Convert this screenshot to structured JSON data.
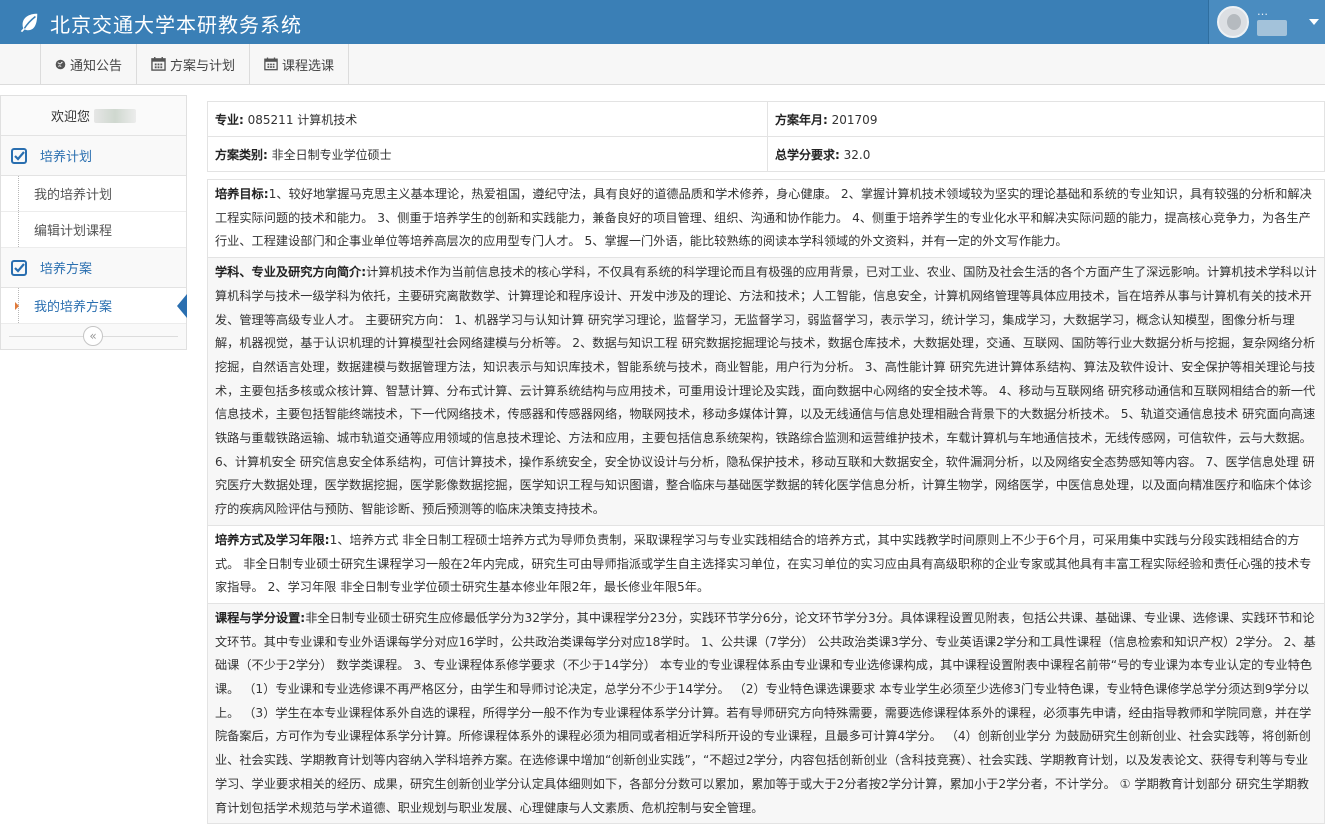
{
  "header": {
    "app_title": "北京交通大学本研教务系统",
    "user_name": "…"
  },
  "nav": {
    "items": [
      {
        "label": "通知公告",
        "icon": "globe-icon"
      },
      {
        "label": "方案与计划",
        "icon": "calendar-icon"
      },
      {
        "label": "课程选课",
        "icon": "calendar-icon"
      }
    ]
  },
  "sidebar": {
    "welcome": "欢迎您",
    "group1": "培养计划",
    "group1_items": [
      "我的培养计划",
      "编辑计划课程"
    ],
    "group2": "培养方案",
    "group2_items": [
      "我的培养方案"
    ],
    "collapse_icon": "«"
  },
  "info": {
    "major_label": "专业:",
    "major_value": "085211 计算机技术",
    "plan_date_label": "方案年月:",
    "plan_date_value": "201709",
    "category_label": "方案类别:",
    "category_value": "非全日制专业学位硕士",
    "credits_label": "总学分要求:",
    "credits_value": "32.0"
  },
  "sections": [
    {
      "title": "培养目标:",
      "text": "1、较好地掌握马克思主义基本理论，热爱祖国，遵纪守法，具有良好的道德品质和学术修养，身心健康。 2、掌握计算机技术领域较为坚实的理论基础和系统的专业知识，具有较强的分析和解决工程实际问题的技术和能力。 3、侧重于培养学生的创新和实践能力，兼备良好的项目管理、组织、沟通和协作能力。 4、侧重于培养学生的专业化水平和解决实际问题的能力，提高核心竞争力，为各生产行业、工程建设部门和企事业单位等培养高层次的应用型专门人才。 5、掌握一门外语，能比较熟练的阅读本学科领域的外文资料，并有一定的外文写作能力。"
    },
    {
      "title": "学科、专业及研究方向简介:",
      "text": "计算机技术作为当前信息技术的核心学科，不仅具有系统的科学理论而且有极强的应用背景，已对工业、农业、国防及社会生活的各个方面产生了深远影响。计算机技术学科以计算机科学与技术一级学科为依托，主要研究离散数学、计算理论和程序设计、开发中涉及的理论、方法和技术；人工智能，信息安全，计算机网络管理等具体应用技术，旨在培养从事与计算机有关的技术开发、管理等高级专业人才。 主要研究方向： 1、机器学习与认知计算 研究学习理论，监督学习，无监督学习，弱监督学习，表示学习，统计学习，集成学习，大数据学习，概念认知模型，图像分析与理解，机器视觉，基于认识机理的计算模型社会网络建模与分析等。 2、数据与知识工程 研究数据挖掘理论与技术，数据仓库技术，大数据处理，交通、互联网、国防等行业大数据分析与挖掘，复杂网络分析挖掘，自然语言处理，数据建模与数据管理方法，知识表示与知识库技术，智能系统与技术，商业智能，用户行为分析。 3、高性能计算 研究先进计算体系结构、算法及软件设计、安全保护等相关理论与技术，主要包括多核或众核计算、智慧计算、分布式计算、云计算系统结构与应用技术，可重用设计理论及实践，面向数据中心网络的安全技术等。 4、移动与互联网络 研究移动通信和互联网相结合的新一代信息技术，主要包括智能终端技术，下一代网络技术，传感器和传感器网络，物联网技术，移动多媒体计算，以及无线通信与信息处理相融合背景下的大数据分析技术。 5、轨道交通信息技术 研究面向高速铁路与重载铁路运输、城市轨道交通等应用领域的信息技术理论、方法和应用，主要包括信息系统架构，铁路综合监测和运营维护技术，车载计算机与车地通信技术，无线传感网，可信软件，云与大数据。 6、计算机安全 研究信息安全体系结构，可信计算技术，操作系统安全，安全协议设计与分析，隐私保护技术，移动互联和大数据安全，软件漏洞分析，以及网络安全态势感知等内容。 7、医学信息处理 研究医疗大数据处理，医学数据挖掘，医学影像数据挖掘，医学知识工程与知识图谱，整合临床与基础医学数据的转化医学信息分析，计算生物学，网络医学，中医信息处理，以及面向精准医疗和临床个体诊疗的疾病风险评估与预防、智能诊断、预后预测等的临床决策支持技术。"
    },
    {
      "title": "培养方式及学习年限:",
      "text": "1、培养方式 非全日制工程硕士培养方式为导师负责制，采取课程学习与专业实践相结合的培养方式，其中实践教学时间原则上不少于6个月，可采用集中实践与分段实践相结合的方式。 非全日制专业硕士研究生课程学习一般在2年内完成，研究生可由导师指派或学生自主选择实习单位，在实习单位的实习应由具有高级职称的企业专家或其他具有丰富工程实际经验和责任心强的技术专家指导。 2、学习年限 非全日制专业学位硕士研究生基本修业年限2年，最长修业年限5年。"
    },
    {
      "title": "课程与学分设置:",
      "text": "非全日制专业硕士研究生应修最低学分为32学分，其中课程学分23分，实践环节学分6分，论文环节学分3分。具体课程设置见附表，包括公共课、基础课、专业课、选修课、实践环节和论文环节。其中专业课和专业外语课每学分对应16学时，公共政治类课每学分对应18学时。 1、公共课（7学分） 公共政治类课3学分、专业英语课2学分和工具性课程（信息检索和知识产权）2学分。 2、基础课（不少于2学分） 数学类课程。 3、专业课程体系修学要求（不少于14学分） 本专业的专业课程体系由专业课和专业选修课构成，其中课程设置附表中课程名前带“号的专业课为本专业认定的专业特色课。 （1）专业课和专业选修课不再严格区分，由学生和导师讨论决定，总学分不少于14学分。 （2）专业特色课选课要求 本专业学生必须至少选修3门专业特色课，专业特色课修学总学分须达到9学分以上。 （3）学生在本专业课程体系外自选的课程，所得学分一般不作为专业课程体系学分计算。若有导师研究方向特殊需要，需要选修课程体系外的课程，必须事先申请，经由指导教师和学院同意，并在学院备案后，方可作为专业课程体系学分计算。所修课程体系外的课程必须为相同或者相近学科所开设的专业课程，且最多可计算4学分。 （4）创新创业学分 为鼓励研究生创新创业、社会实践等，将创新创业、社会实践、学期教育计划等内容纳入学科培养方案。在选修课中增加“创新创业实践”，“不超过2学分，内容包括创新创业（含科技竞赛）、社会实践、学期教育计划，以及发表论文、获得专利等与专业学习、学业要求相关的经历、成果，研究生创新创业学分认定具体细则如下，各部分分数可以累加，累加等于或大于2分者按2学分计算，累加小于2学分者，不计学分。 ① 学期教育计划部分 研究生学期教育计划包括学术规范与学术道德、职业规划与职业发展、心理健康与人文素质、危机控制与安全管理。"
    }
  ],
  "colors": {
    "header_bg": "#3a7fb6",
    "accent": "#2a6fb0"
  }
}
